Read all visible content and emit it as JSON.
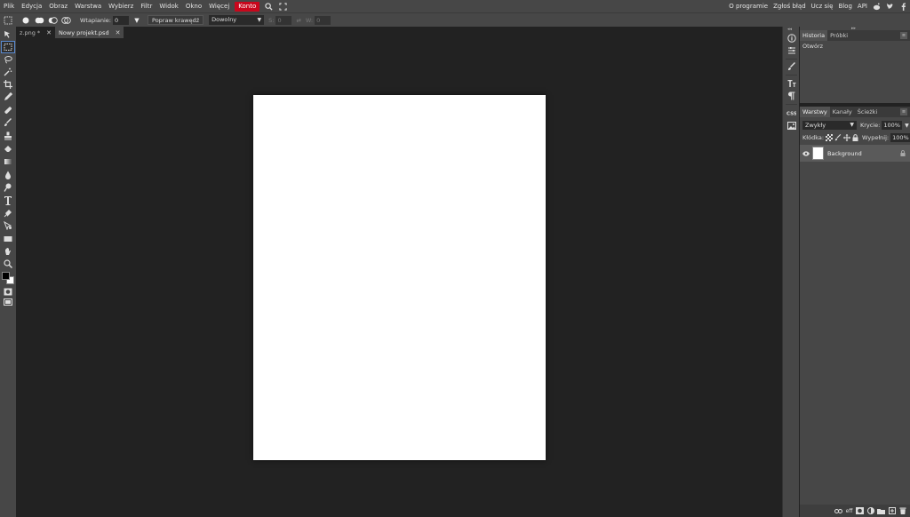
{
  "menu": {
    "items": [
      "Plik",
      "Edycja",
      "Obraz",
      "Warstwa",
      "Wybierz",
      "Filtr",
      "Widok",
      "Okno",
      "Więcej"
    ],
    "account": "Konto",
    "right": [
      "O programie",
      "Zgłoś błąd",
      "Ucz się",
      "Blog",
      "API"
    ],
    "accent": "#c8071c"
  },
  "options": {
    "feather_label": "Wtapianie:",
    "feather_value": "0 px",
    "refine_button": "Popraw krawędź",
    "mode_value": "Dowolny",
    "w_label": "S:",
    "w_value": "0",
    "h_label": "W:",
    "h_value": "0"
  },
  "tabs": [
    {
      "label": "z.png *"
    },
    {
      "label": "Nowy projekt.psd"
    }
  ],
  "history": {
    "tabs": [
      "Historia",
      "Próbki"
    ],
    "items": [
      "Otwórz"
    ]
  },
  "layers": {
    "tabs": [
      "Warstwy",
      "Kanały",
      "Ścieżki"
    ],
    "blend_mode": "Zwykły",
    "opacity_label": "Krycie:",
    "opacity_value": "100%",
    "lock_label": "Kłódka:",
    "fill_label": "Wypełnij:",
    "fill_value": "100%",
    "items": [
      {
        "name": "Background"
      }
    ]
  }
}
